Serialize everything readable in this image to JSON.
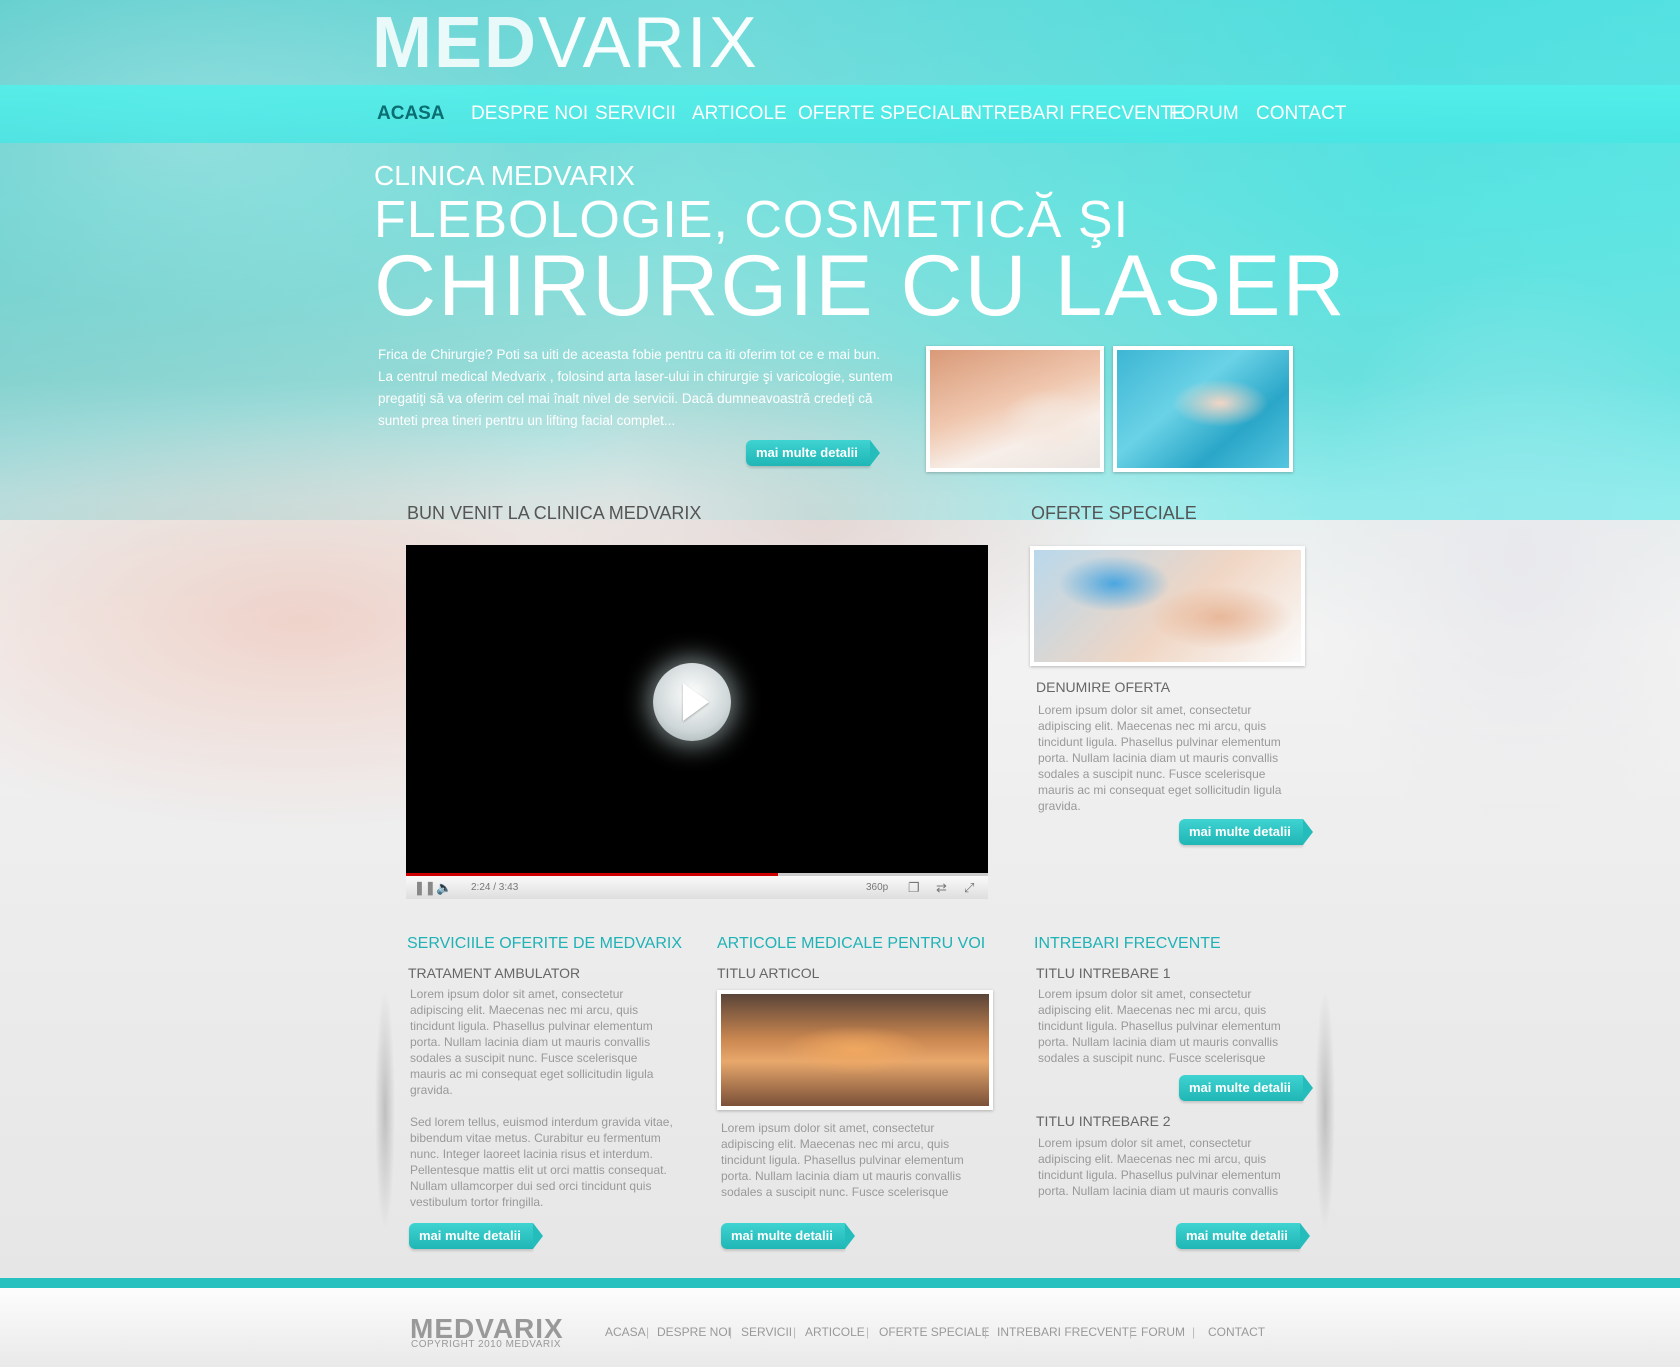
{
  "brand": {
    "logo_bold": "MED",
    "logo_light": "VARIX"
  },
  "nav": {
    "items": [
      {
        "label": "ACASA",
        "active": true
      },
      {
        "label": "DESPRE NOI"
      },
      {
        "label": "SERVICII"
      },
      {
        "label": "ARTICOLE"
      },
      {
        "label": "OFERTE SPECIALE"
      },
      {
        "label": "INTREBARI FRECVENTE"
      },
      {
        "label": "FORUM"
      },
      {
        "label": "CONTACT"
      }
    ]
  },
  "hero": {
    "line1": "CLINICA MEDVARIX",
    "line2": "FLEBOLOGIE, COSMETICĂ ŞI",
    "line3": "CHIRURGIE CU LASER",
    "intro": "Frica de Chirurgie? Poti sa uiti de aceasta fobie pentru ca iti oferim tot ce e mai bun. La centrul medical Medvarix , folosind arta laser-ului in chirurgie şi varicologie, suntem pregatiţi să va oferim cel mai înalt nivel de servicii. Dacă dumneavoastră credeţi că sunteti prea tineri pentru un lifting facial complet...",
    "button": "mai multe detalii"
  },
  "welcome": {
    "title": "BUN VENIT LA CLINICA MEDVARIX",
    "video": {
      "time": "2:24 / 3:43",
      "quality": "360p",
      "progress": 0.64
    }
  },
  "offers": {
    "title": "OFERTE SPECIALE",
    "item_title": "DENUMIRE OFERTA",
    "text": "Lorem ipsum dolor sit amet, consectetur adipiscing elit. Maecenas nec mi arcu, quis tincidunt ligula. Phasellus pulvinar elementum porta. Nullam lacinia diam ut mauris convallis sodales a suscipit nunc. Fusce scelerisque mauris ac mi consequat eget sollicitudin ligula gravida.",
    "button": "mai multe detalii"
  },
  "services": {
    "title": "SERVICIILE OFERITE DE MEDVARIX",
    "item_title": "TRATAMENT AMBULATOR",
    "text1": "Lorem ipsum dolor sit amet, consectetur adipiscing elit. Maecenas nec mi arcu, quis tincidunt ligula. Phasellus pulvinar elementum porta. Nullam lacinia diam ut mauris convallis sodales a suscipit nunc. Fusce scelerisque mauris ac mi consequat eget sollicitudin ligula gravida.",
    "text2": "Sed lorem tellus, euismod interdum gravida vitae, bibendum vitae metus. Curabitur eu fermentum nunc. Integer laoreet lacinia risus et interdum. Pellentesque mattis elit ut orci mattis consequat. Nullam ullamcorper dui sed orci tincidunt quis vestibulum tortor fringilla.",
    "button": "mai multe detalii"
  },
  "articles": {
    "title": "ARTICOLE MEDICALE PENTRU VOI",
    "item_title": "TITLU ARTICOL",
    "text": "Lorem ipsum dolor sit amet, consectetur adipiscing elit. Maecenas nec mi arcu, quis tincidunt ligula. Phasellus pulvinar elementum porta. Nullam lacinia diam ut mauris convallis sodales a suscipit nunc. Fusce scelerisque",
    "button": "mai multe detalii"
  },
  "faq": {
    "title": "INTREBARI FRECVENTE",
    "q1_title": "TITLU INTREBARE 1",
    "q1_text": "Lorem ipsum dolor sit amet, consectetur adipiscing elit. Maecenas nec mi arcu, quis tincidunt ligula. Phasellus pulvinar elementum porta. Nullam lacinia diam ut mauris convallis sodales a suscipit nunc. Fusce scelerisque",
    "q1_button": "mai multe detalii",
    "q2_title": "TITLU INTREBARE 2",
    "q2_text": "Lorem ipsum dolor sit amet, consectetur adipiscing elit. Maecenas nec mi arcu, quis tincidunt ligula. Phasellus pulvinar elementum porta. Nullam lacinia diam ut mauris convallis",
    "q2_button": "mai multe detalii"
  },
  "footer": {
    "logo": "MEDVARIX",
    "copyright": "COPYRIGHT 2010 MEDVARIX",
    "links": [
      "ACASA",
      "DESPRE NOI",
      "SERVICII",
      "ARTICOLE",
      "OFERTE SPECIALE",
      "INTREBARI FRECVENTE",
      "FORUM",
      "CONTACT"
    ],
    "separator": "|"
  },
  "colors": {
    "accent": "#1fb6b5",
    "nav_active": "#0a6e72",
    "footer_bar": "#27c2c0"
  }
}
